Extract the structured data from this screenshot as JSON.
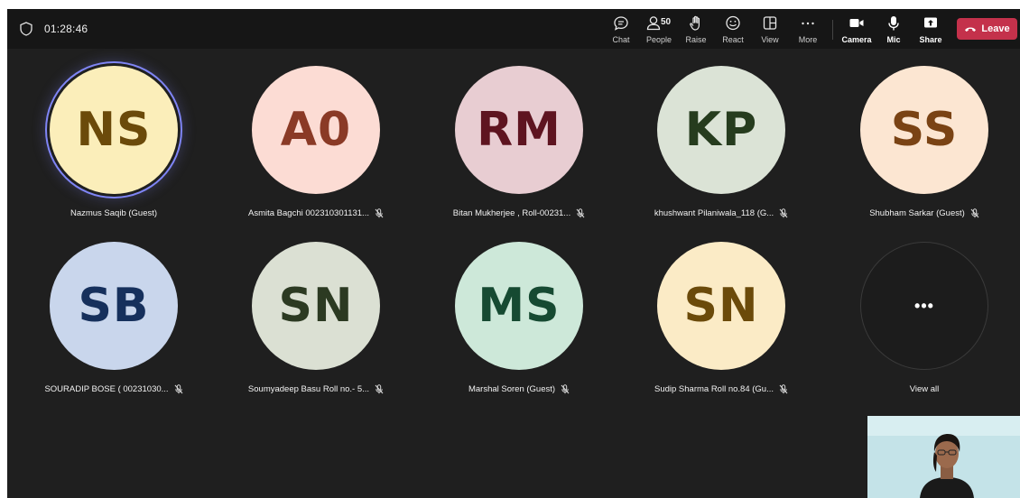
{
  "meeting": {
    "timer": "01:28:46"
  },
  "toolbar": {
    "chat": "Chat",
    "people": "People",
    "people_count": "50",
    "raise": "Raise",
    "react": "React",
    "view": "View",
    "more": "More",
    "camera": "Camera",
    "mic": "Mic",
    "share": "Share",
    "leave": "Leave",
    "leave_color": "#c4314b"
  },
  "participants": [
    {
      "initials": "NS",
      "name": "Nazmus Saqib (Guest)",
      "bg": "#fbeeba",
      "fg": "#6b4a0a",
      "muted": false,
      "speaking": true
    },
    {
      "initials": "A0",
      "name": "Asmita Bagchi 002310301131...",
      "bg": "#fcdcd4",
      "fg": "#8a3a26",
      "muted": true,
      "speaking": false
    },
    {
      "initials": "RM",
      "name": "Bitan Mukherjee , Roll-00231...",
      "bg": "#e8cdd2",
      "fg": "#5e1420",
      "muted": true,
      "speaking": false
    },
    {
      "initials": "KP",
      "name": "khushwant Pilaniwala_118 (G...",
      "bg": "#dbe3d6",
      "fg": "#263c1e",
      "muted": true,
      "speaking": false
    },
    {
      "initials": "SS",
      "name": "Shubham Sarkar (Guest)",
      "bg": "#fce6d2",
      "fg": "#7a4314",
      "muted": true,
      "speaking": false
    },
    {
      "initials": "SB",
      "name": "SOURADIP BOSE ( 00231030...",
      "bg": "#c9d6ec",
      "fg": "#16305c",
      "muted": true,
      "speaking": false
    },
    {
      "initials": "SN",
      "name": "Soumyadeep Basu Roll no.- 5...",
      "bg": "#dbe0d3",
      "fg": "#2c3a22",
      "muted": true,
      "speaking": false
    },
    {
      "initials": "MS",
      "name": "Marshal Soren (Guest)",
      "bg": "#cde8d9",
      "fg": "#164a32",
      "muted": true,
      "speaking": false
    },
    {
      "initials": "SN",
      "name": "Sudip Sharma Roll no.84 (Gu...",
      "bg": "#fbebc6",
      "fg": "#6b4a0a",
      "muted": true,
      "speaking": false
    }
  ],
  "view_all": {
    "dots": "•••",
    "label": "View all"
  }
}
